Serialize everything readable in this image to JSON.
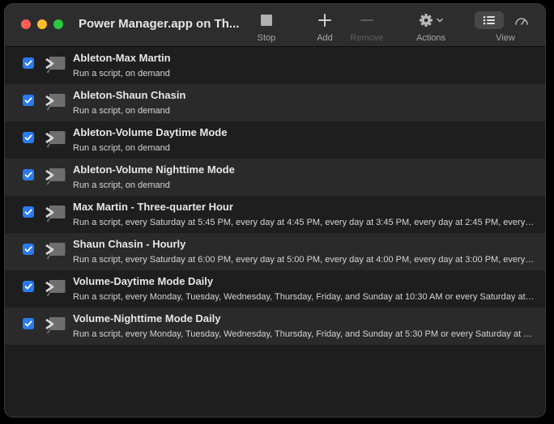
{
  "window": {
    "title": "Power Manager.app on Th..."
  },
  "toolbar": {
    "stop_label": "Stop",
    "add_label": "Add",
    "remove_label": "Remove",
    "actions_label": "Actions",
    "view_label": "View"
  },
  "colors": {
    "accent": "#2b7bf0",
    "close": "#ff5f57",
    "minimize": "#febc2e",
    "zoom": "#28c840"
  },
  "events": [
    {
      "name": "Ableton-Max Martin",
      "description": "Run a script, on demand",
      "enabled": true
    },
    {
      "name": "Ableton-Shaun Chasin",
      "description": "Run a script, on demand",
      "enabled": true
    },
    {
      "name": "Ableton-Volume Daytime Mode",
      "description": "Run a script, on demand",
      "enabled": true
    },
    {
      "name": "Ableton-Volume Nighttime Mode",
      "description": "Run a script, on demand",
      "enabled": true
    },
    {
      "name": "Max Martin - Three-quarter Hour",
      "description": "Run a script, every Saturday at 5:45 PM, every day at 4:45 PM, every day at 3:45 PM, every day at 2:45 PM, every day…",
      "enabled": true
    },
    {
      "name": "Shaun Chasin - Hourly",
      "description": "Run a script, every Saturday at 6:00 PM, every day at 5:00 PM, every day at 4:00 PM, every day at 3:00 PM, every da…",
      "enabled": true
    },
    {
      "name": "Volume-Daytime Mode Daily",
      "description": "Run a script, every Monday, Tuesday, Wednesday, Thursday, Friday, and Sunday at 10:30 AM or every Saturday at 9:3…",
      "enabled": true
    },
    {
      "name": "Volume-Nighttime Mode Daily",
      "description": "Run a script, every Monday, Tuesday, Wednesday, Thursday, Friday, and Sunday at 5:30 PM or every Saturday at 6:30…",
      "enabled": true
    }
  ]
}
